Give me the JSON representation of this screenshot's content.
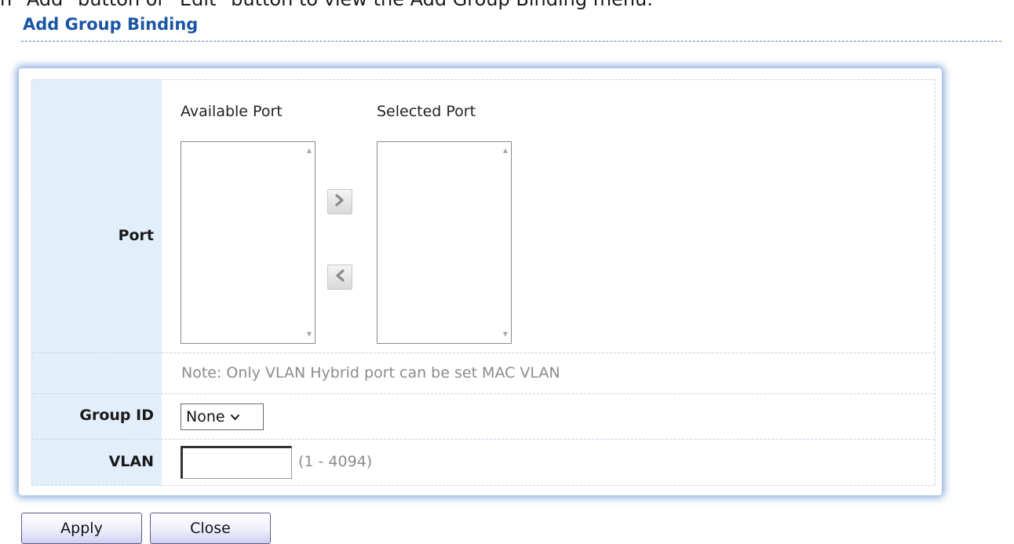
{
  "caption_cut": "n \"Add\" button or \"Edit\" button to view the Add Group Binding menu.",
  "section": {
    "title": "Add Group Binding"
  },
  "port": {
    "label": "Port",
    "available_header": "Available Port",
    "selected_header": "Selected Port",
    "available_items": [],
    "selected_items": [],
    "move_right_icon": "chevron-right-icon",
    "move_left_icon": "chevron-left-icon",
    "note": "Note: Only VLAN Hybrid port can be set MAC VLAN"
  },
  "group_id": {
    "label": "Group ID",
    "selected": "None"
  },
  "vlan": {
    "label": "VLAN",
    "value": "",
    "range": "(1 - 4094)"
  },
  "buttons": {
    "apply": "Apply",
    "close": "Close"
  }
}
